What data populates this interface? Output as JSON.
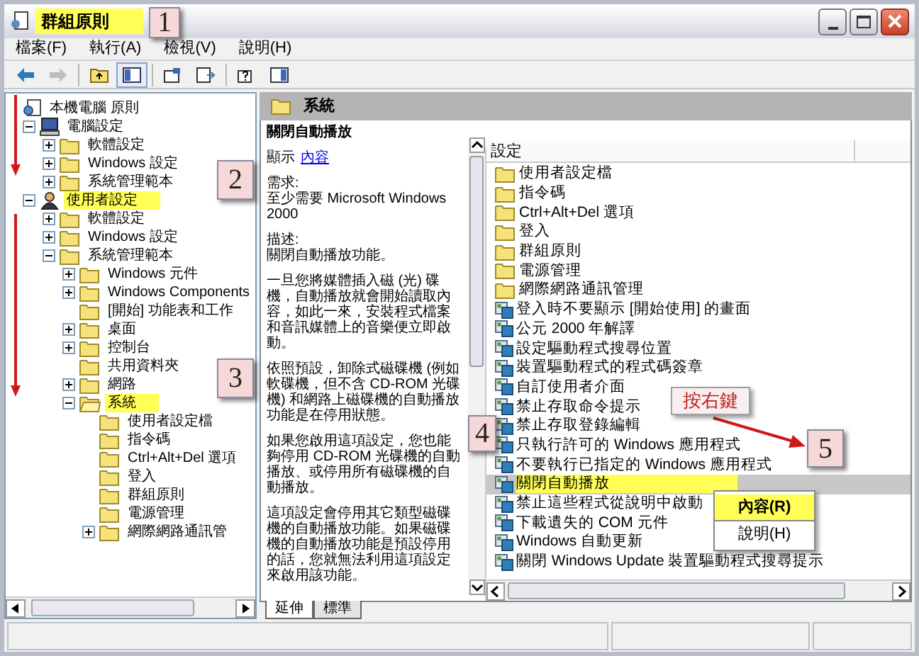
{
  "window": {
    "title": "群組原則",
    "title_highlighted": true
  },
  "menu": [
    {
      "label": "檔案(F)"
    },
    {
      "label": "執行(A)"
    },
    {
      "label": "檢視(V)"
    },
    {
      "label": "說明(H)"
    }
  ],
  "toolbar": [
    {
      "kind": "back",
      "disabled": false
    },
    {
      "kind": "forward",
      "disabled": true
    },
    {
      "kind": "separator"
    },
    {
      "kind": "up",
      "disabled": false
    },
    {
      "kind": "tree",
      "disabled": false,
      "pressed": true
    },
    {
      "kind": "separator"
    },
    {
      "kind": "properties",
      "disabled": false
    },
    {
      "kind": "export",
      "disabled": false
    },
    {
      "kind": "separator"
    },
    {
      "kind": "help",
      "disabled": false
    },
    {
      "kind": "pane",
      "disabled": false
    }
  ],
  "tree": [
    {
      "label": "本機電腦 原則",
      "kind": "policy",
      "expandable": false,
      "expanded": true,
      "selected": false,
      "highlighted": false,
      "children": [
        {
          "label": "電腦設定",
          "kind": "computer",
          "expandable": true,
          "expanded": true,
          "selected": false,
          "highlighted": false,
          "children": [
            {
              "label": "軟體設定",
              "kind": "folder",
              "expandable": true,
              "expanded": false,
              "selected": false,
              "highlighted": false
            },
            {
              "label": "Windows 設定",
              "kind": "folder",
              "expandable": true,
              "expanded": false,
              "selected": false,
              "highlighted": false
            },
            {
              "label": "系統管理範本",
              "kind": "folder",
              "expandable": true,
              "expanded": false,
              "selected": false,
              "highlighted": false
            }
          ]
        },
        {
          "label": "使用者設定",
          "kind": "user",
          "expandable": true,
          "expanded": true,
          "selected": false,
          "highlighted": true,
          "children": [
            {
              "label": "軟體設定",
              "kind": "folder",
              "expandable": true,
              "expanded": false,
              "selected": false,
              "highlighted": false
            },
            {
              "label": "Windows 設定",
              "kind": "folder",
              "expandable": true,
              "expanded": false,
              "selected": false,
              "highlighted": false
            },
            {
              "label": "系統管理範本",
              "kind": "folder",
              "expandable": true,
              "expanded": true,
              "selected": false,
              "highlighted": false,
              "children": [
                {
                  "label": "Windows 元件",
                  "kind": "folder",
                  "expandable": true,
                  "expanded": false,
                  "selected": false,
                  "highlighted": false
                },
                {
                  "label": "Windows Components",
                  "kind": "folder",
                  "expandable": true,
                  "expanded": false,
                  "selected": false,
                  "highlighted": false
                },
                {
                  "label": "[開始] 功能表和工作",
                  "kind": "folder",
                  "expandable": false,
                  "expanded": false,
                  "selected": false,
                  "highlighted": false
                },
                {
                  "label": "桌面",
                  "kind": "folder",
                  "expandable": true,
                  "expanded": false,
                  "selected": false,
                  "highlighted": false
                },
                {
                  "label": "控制台",
                  "kind": "folder",
                  "expandable": true,
                  "expanded": false,
                  "selected": false,
                  "highlighted": false
                },
                {
                  "label": "共用資料夾",
                  "kind": "folder",
                  "expandable": false,
                  "expanded": false,
                  "selected": false,
                  "highlighted": false
                },
                {
                  "label": "網路",
                  "kind": "folder",
                  "expandable": true,
                  "expanded": false,
                  "selected": false,
                  "highlighted": false
                },
                {
                  "label": "系統",
                  "kind": "folder",
                  "expandable": true,
                  "expanded": true,
                  "selected": true,
                  "highlighted": true,
                  "children": [
                    {
                      "label": "使用者設定檔",
                      "kind": "folder",
                      "expandable": false,
                      "expanded": false,
                      "selected": false,
                      "highlighted": false
                    },
                    {
                      "label": "指令碼",
                      "kind": "folder",
                      "expandable": false,
                      "expanded": false,
                      "selected": false,
                      "highlighted": false
                    },
                    {
                      "label": "Ctrl+Alt+Del 選項",
                      "kind": "folder",
                      "expandable": false,
                      "expanded": false,
                      "selected": false,
                      "highlighted": false
                    },
                    {
                      "label": "登入",
                      "kind": "folder",
                      "expandable": false,
                      "expanded": false,
                      "selected": false,
                      "highlighted": false
                    },
                    {
                      "label": "群組原則",
                      "kind": "folder",
                      "expandable": false,
                      "expanded": false,
                      "selected": false,
                      "highlighted": false
                    },
                    {
                      "label": "電源管理",
                      "kind": "folder",
                      "expandable": false,
                      "expanded": false,
                      "selected": false,
                      "highlighted": false
                    },
                    {
                      "label": "網際網路通訊管",
                      "kind": "folder",
                      "expandable": true,
                      "expanded": false,
                      "selected": false,
                      "highlighted": false
                    }
                  ]
                }
              ]
            }
          ]
        }
      ]
    }
  ],
  "header": {
    "title": "系統"
  },
  "description": {
    "title": "關閉自動播放",
    "show_label": "顯示",
    "link": "內容",
    "sections": [
      {
        "heading": "需求:",
        "text": "至少需要 Microsoft Windows 2000"
      },
      {
        "heading": "描述:",
        "text": "關閉自動播放功能。"
      }
    ],
    "paragraphs": [
      "一旦您將媒體插入磁 (光) 碟機，自動播放就會開始讀取內容，如此一來，安裝程式檔案和音訊媒體上的音樂便立即啟動。",
      "依照預設，卸除式磁碟機 (例如軟碟機，但不含 CD-ROM 光碟機) 和網路上磁碟機的自動播放功能是在停用狀態。",
      "如果您啟用這項設定，您也能夠停用 CD-ROM 光碟機的自動播放、或停用所有磁碟機的自動播放。",
      "這項設定會停用其它類型磁碟機的自動播放功能。如果磁碟機的自動播放功能是預設停用的話，您就無法利用這項設定來啟用該功能。"
    ]
  },
  "list": {
    "columns": [
      "設定"
    ],
    "items": [
      {
        "label": "使用者設定檔",
        "kind": "folder",
        "selected": false,
        "highlighted": false
      },
      {
        "label": "指令碼",
        "kind": "folder",
        "selected": false,
        "highlighted": false
      },
      {
        "label": "Ctrl+Alt+Del 選項",
        "kind": "folder",
        "selected": false,
        "highlighted": false
      },
      {
        "label": "登入",
        "kind": "folder",
        "selected": false,
        "highlighted": false
      },
      {
        "label": "群組原則",
        "kind": "folder",
        "selected": false,
        "highlighted": false
      },
      {
        "label": "電源管理",
        "kind": "folder",
        "selected": false,
        "highlighted": false
      },
      {
        "label": "網際網路通訊管理",
        "kind": "folder",
        "selected": false,
        "highlighted": false
      },
      {
        "label": "登入時不要顯示 [開始使用] 的畫面",
        "kind": "setting",
        "selected": false,
        "highlighted": false
      },
      {
        "label": "公元 2000 年解譯",
        "kind": "setting",
        "selected": false,
        "highlighted": false
      },
      {
        "label": "設定驅動程式搜尋位置",
        "kind": "setting",
        "selected": false,
        "highlighted": false
      },
      {
        "label": "裝置驅動程式的程式碼簽章",
        "kind": "setting",
        "selected": false,
        "highlighted": false
      },
      {
        "label": "自訂使用者介面",
        "kind": "setting",
        "selected": false,
        "highlighted": false
      },
      {
        "label": "禁止存取命令提示",
        "kind": "setting",
        "selected": false,
        "highlighted": false
      },
      {
        "label": "禁止存取登錄編輯",
        "kind": "setting",
        "selected": false,
        "highlighted": false
      },
      {
        "label": "只執行許可的 Windows 應用程式",
        "kind": "setting",
        "selected": false,
        "highlighted": false
      },
      {
        "label": "不要執行已指定的 Windows 應用程式",
        "kind": "setting",
        "selected": false,
        "highlighted": false
      },
      {
        "label": "關閉自動播放",
        "kind": "setting",
        "selected": true,
        "highlighted": true
      },
      {
        "label": "禁止這些程式從說明中啟動",
        "kind": "setting",
        "selected": false,
        "highlighted": false
      },
      {
        "label": "下載遺失的 COM 元件",
        "kind": "setting",
        "selected": false,
        "highlighted": false
      },
      {
        "label": "Windows 自動更新",
        "kind": "setting",
        "selected": false,
        "highlighted": false
      },
      {
        "label": "關閉 Windows Update 裝置驅動程式搜尋提示",
        "kind": "setting",
        "selected": false,
        "highlighted": false
      }
    ]
  },
  "context_menu": [
    {
      "label": "內容(R)",
      "highlighted": true
    },
    {
      "label": "說明(H)",
      "highlighted": false
    }
  ],
  "tabs": [
    {
      "label": "延伸",
      "selected": true
    },
    {
      "label": "標準",
      "selected": false
    }
  ],
  "annotations": [
    {
      "kind": "number",
      "label": "1"
    },
    {
      "kind": "number",
      "label": "2"
    },
    {
      "kind": "number",
      "label": "3"
    },
    {
      "kind": "number",
      "label": "4"
    },
    {
      "kind": "number",
      "label": "5"
    },
    {
      "kind": "callout",
      "label": "按右鍵"
    }
  ]
}
